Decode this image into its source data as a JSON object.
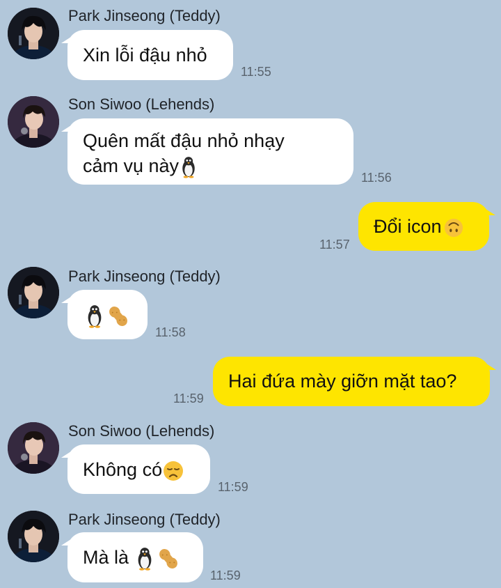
{
  "colors": {
    "background": "#b2c7da",
    "incoming_bubble": "#ffffff",
    "outgoing_bubble": "#fee500",
    "timestamp": "#59636d"
  },
  "messages": [
    {
      "sender": "Park Jinseong (Teddy)",
      "text": "Xin lỗi đậu nhỏ",
      "time": "11:55",
      "avatar_icon": "teddy-avatar"
    },
    {
      "sender": "Son Siwoo (Lehends)",
      "text_line1": "Quên mất đậu nhỏ nhạy",
      "text_line2": "cảm vụ này",
      "time": "11:56",
      "emoji_icons": [
        "penguin-icon"
      ],
      "avatar_icon": "lehends-avatar"
    },
    {
      "text": "Đổi icon",
      "time": "11:57",
      "emoji_icons": [
        "upside-down-face-icon"
      ]
    },
    {
      "sender": "Park Jinseong (Teddy)",
      "time": "11:58",
      "emoji_icons": [
        "penguin-icon",
        "peanut-icon"
      ],
      "avatar_icon": "teddy-avatar"
    },
    {
      "text": "Hai đứa mày giỡn mặt tao?",
      "time": "11:59"
    },
    {
      "sender": "Son Siwoo (Lehends)",
      "text": "Không có",
      "time": "11:59",
      "emoji_icons": [
        "disappointed-face-icon"
      ],
      "avatar_icon": "lehends-avatar"
    },
    {
      "sender": "Park Jinseong (Teddy)",
      "text": "Mà là ",
      "time": "11:59",
      "emoji_icons": [
        "penguin-icon",
        "peanut-icon"
      ],
      "avatar_icon": "teddy-avatar"
    }
  ]
}
